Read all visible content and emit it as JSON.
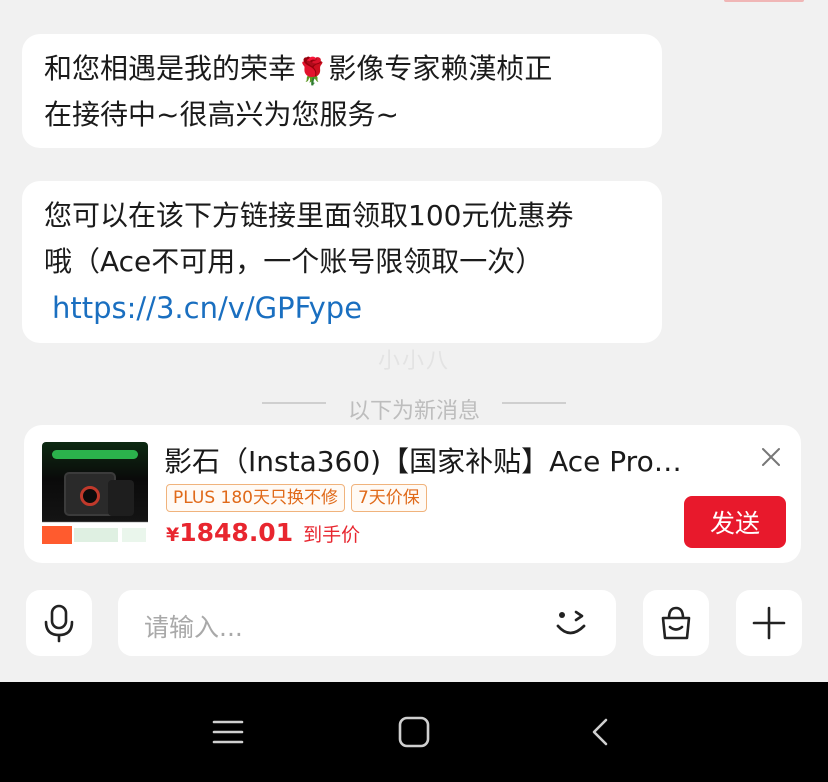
{
  "messages": [
    {
      "line1": "和您相遇是我的荣幸",
      "emoji": "🌹",
      "line1_tail": "影像专家赖漢桢正",
      "line2": "在接待中~很高兴为您服务~"
    },
    {
      "line1": "您可以在该下方链接里面领取100元优惠券",
      "line2": "哦（Ace不可用，一个账号限领取一次）",
      "link": "https://3.cn/v/GPFype"
    }
  ],
  "watermark": "小小八",
  "divider_text": "以下为新消息",
  "product_card": {
    "title": "影石（Insta360)【国家补贴】Ace Pro…",
    "tags": [
      "PLUS 180天只换不修",
      "7天价保"
    ],
    "price_symbol": "¥",
    "price": "1848.01",
    "price_note": "到手价",
    "send_label": "发送"
  },
  "input": {
    "placeholder": "请输入..."
  },
  "icons": {
    "mic": "microphone-icon",
    "emoji": "wink-face-icon",
    "bag": "shopping-bag-icon",
    "plus": "plus-icon",
    "close": "close-icon",
    "nav_menu": "menu-icon",
    "nav_home": "home-square-icon",
    "nav_back": "back-chevron-icon"
  },
  "colors": {
    "link": "#1a6fc0",
    "price": "#e8262f",
    "send_button": "#e8192c",
    "tag_border": "#f0b37c",
    "tag_text": "#e06a1a"
  }
}
